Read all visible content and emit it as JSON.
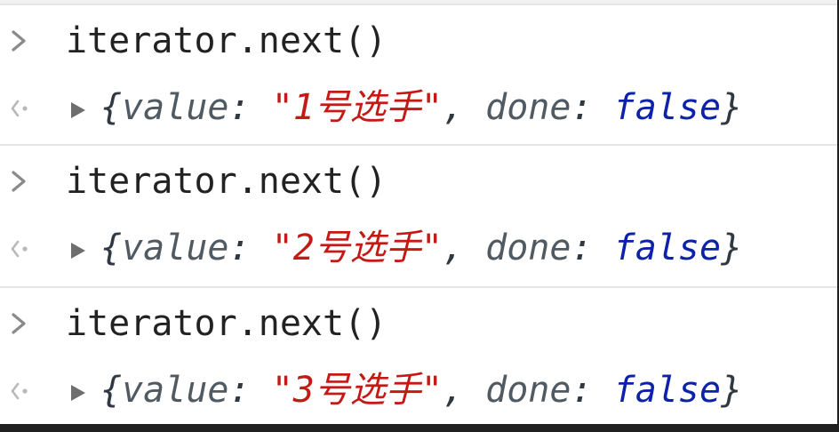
{
  "console": {
    "entries": [
      {
        "input": "iterator.next()",
        "result": {
          "open_brace": "{",
          "value_key": "value",
          "colon1": ":",
          "value": "\"1号选手\"",
          "comma": ",",
          "done_key": "done",
          "colon2": ":",
          "done": "false",
          "close_brace": "}"
        }
      },
      {
        "input": "iterator.next()",
        "result": {
          "open_brace": "{",
          "value_key": "value",
          "colon1": ":",
          "value": "\"2号选手\"",
          "comma": ",",
          "done_key": "done",
          "colon2": ":",
          "done": "false",
          "close_brace": "}"
        }
      },
      {
        "input": "iterator.next()",
        "result": {
          "open_brace": "{",
          "value_key": "value",
          "colon1": ":",
          "value": "\"3号选手\"",
          "comma": ",",
          "done_key": "done",
          "colon2": ":",
          "done": "false",
          "close_brace": "}"
        }
      }
    ]
  },
  "icons": {
    "input_prompt": "chevron-right-icon",
    "result_prompt": "return-arrow-icon",
    "expand": "triangle-right-icon"
  },
  "colors": {
    "string": "#c41a16",
    "boolean": "#0d22aa",
    "code_text": "#222222"
  }
}
